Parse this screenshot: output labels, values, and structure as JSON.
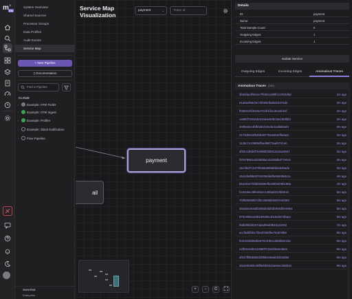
{
  "app": {
    "logo": "m",
    "logo_sup": "+",
    "logo_tag": "EM"
  },
  "nav": {
    "items": [
      {
        "label": "System Overview"
      },
      {
        "label": "Shared Sources"
      },
      {
        "label": "Processor Groups"
      },
      {
        "label": "Data Profiles"
      },
      {
        "label": "Audit Events"
      },
      {
        "label": "Service Map"
      }
    ],
    "new_pipeline": "New Pipeline",
    "documentation": "Documentation",
    "search_placeholder": "Find a Pipeline",
    "cloud_label": "CLOUD",
    "pipelines": [
      {
        "label": "Example: OTel Fields",
        "status": "neutral"
      },
      {
        "label": "Example: OTel Ingest",
        "status": "ok"
      },
      {
        "label": "Example: Profiler",
        "status": "ok"
      },
      {
        "label": "Example: Slack Notification",
        "status": "empty"
      },
      {
        "label": "Flow Pipeline",
        "status": "empty"
      }
    ],
    "user_name": "SvenTest",
    "user_org": "Enterprise"
  },
  "canvas": {
    "title": "Service Map Visualization",
    "service_select": "payment",
    "trace_placeholder": "Trace Id",
    "node_payment": "payment",
    "node_partial": "ail",
    "zoom_in": "+",
    "zoom_out": "−"
  },
  "details": {
    "title": "Details",
    "rows": [
      {
        "key": "ID:",
        "value": "payment"
      },
      {
        "key": "Name:",
        "value": "payment"
      },
      {
        "key": "Total Sample Count:",
        "value": "0"
      },
      {
        "key": "Outgoing Edges:",
        "value": "1"
      },
      {
        "key": "Incoming Edges:",
        "value": "1"
      }
    ],
    "isolate": "Isolate Service",
    "tabs": [
      "Outgoing Edges",
      "Incoming Edges",
      "Anomalous Traces"
    ],
    "anomalous_title": "Anomalous Traces",
    "anomalous_count": "(100)",
    "traces": [
      {
        "id": "db5afaa4f96cee7f6361cd88fc1c902d6d",
        "ago": "1m ago"
      },
      {
        "id": "81a0a4f66cbe73f2691f0a0d16372d2",
        "ago": "2m ago"
      },
      {
        "id": "f0293c24f4024a72c3f1fa1c5e2dc51f",
        "ago": "2m ago"
      },
      {
        "id": "ca88bf7204ed224464e60bc3a12bdbb3",
        "ago": "2m ago"
      },
      {
        "id": "204bedec4bff4391fc26c5c51d6d6ad4",
        "ago": "2m ago"
      },
      {
        "id": "2172d6643f532b4977bea364effa6a4c",
        "ago": "2m ago"
      },
      {
        "id": "1135c7c139894fbad88f73aaf2741eb",
        "ago": "2m ago"
      },
      {
        "id": "df25c1d6d4f7e598bf2bb812a15a384d",
        "ago": "3m ago"
      },
      {
        "id": "f97679961a263538a14a2058bd77e54c",
        "ago": "3m ago"
      },
      {
        "id": "c6ccf5d7c2479f458a89b5bb0a34bade",
        "ago": "3m ago"
      },
      {
        "id": "c5a1d6d9565762039da5f5e58489dcca",
        "ago": "4m ago"
      },
      {
        "id": "b543342783bb5656efbc8d03409b186a",
        "ago": "4m ago"
      },
      {
        "id": "f1c619ec29fe492cc148ba8213fd4015",
        "ago": "5m ago"
      },
      {
        "id": "7f4f508508b7df2c3588d01667ee8363",
        "ago": "5m ago"
      },
      {
        "id": "45aab44ea8d0355d0dd43b9c8df4ee864",
        "ago": "5m ago"
      },
      {
        "id": "970c905a1468159c99c4b16eb07dbacc",
        "ago": "5m ago"
      },
      {
        "id": "f6df2f9fd3f2674dad99ebf53d122402",
        "ago": "7m ago"
      },
      {
        "id": "accf3d0f3917f2ed7550f5e764578b8",
        "ago": "8m ago"
      },
      {
        "id": "fe4c4648d82b2679c405113d8d82e16a",
        "ago": "8m ago"
      },
      {
        "id": "e2fb3ce0d4412580f7cb42f464e39ee",
        "ago": "8m ago"
      },
      {
        "id": "af347ff8b3682d29bb6c65a0dcb34d92",
        "ago": "8m ago"
      },
      {
        "id": "3a1945369c49ff84bb5b1ba0eec268616",
        "ago": "9m ago"
      }
    ]
  }
}
